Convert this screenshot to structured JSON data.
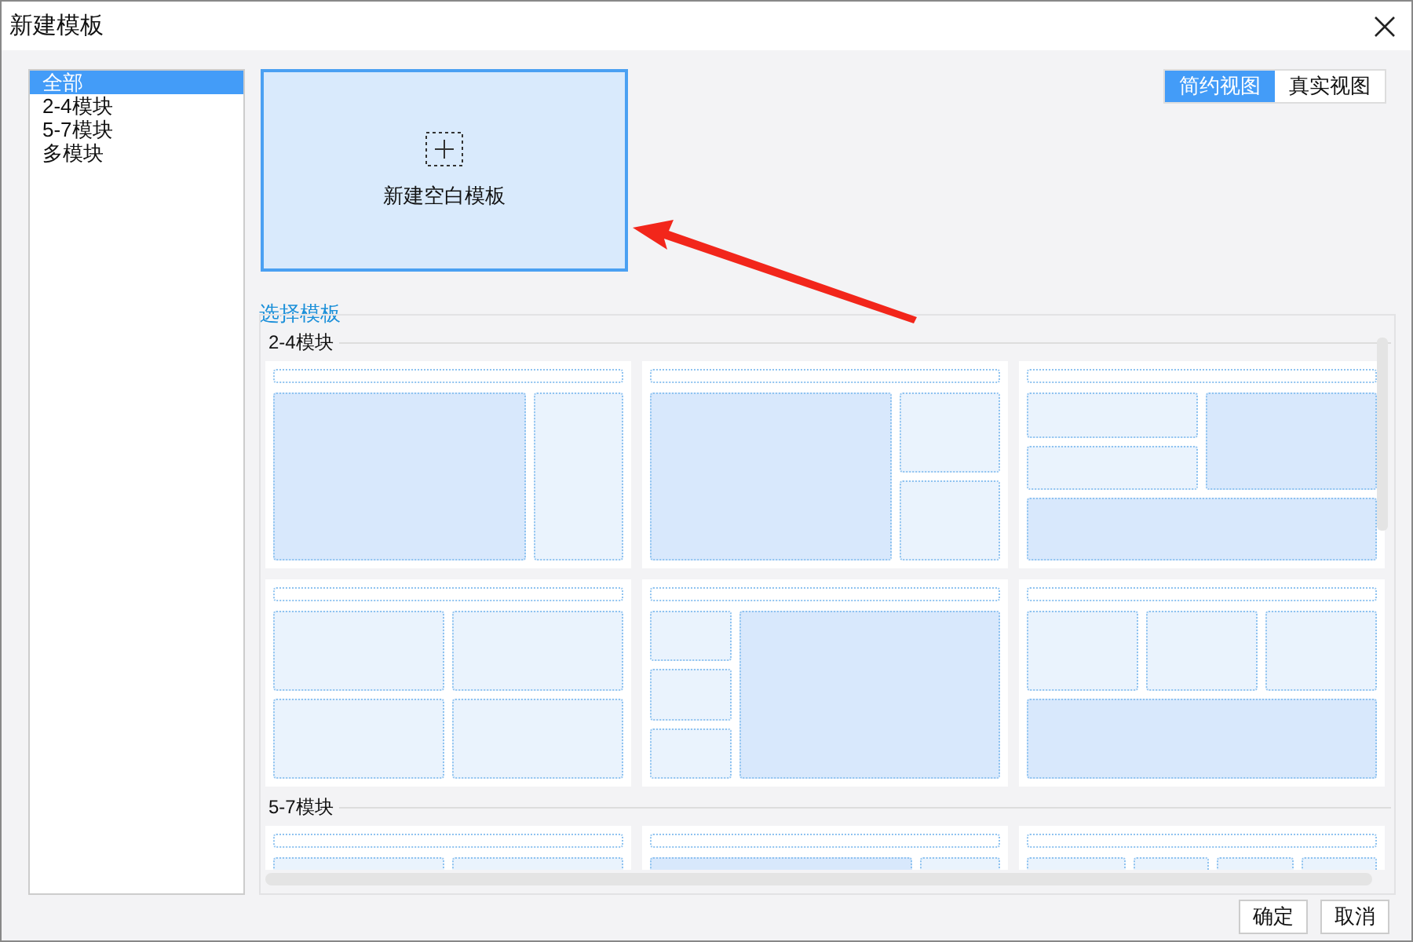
{
  "window": {
    "title": "新建模板"
  },
  "sidebar": {
    "items": [
      {
        "label": "全部",
        "selected": true
      },
      {
        "label": "2-4模块",
        "selected": false
      },
      {
        "label": "5-7模块",
        "selected": false
      },
      {
        "label": "多模块",
        "selected": false
      }
    ]
  },
  "new_template": {
    "label": "新建空白模板"
  },
  "view_toggle": [
    {
      "label": "简约视图",
      "selected": true
    },
    {
      "label": "真实视图",
      "selected": false
    }
  ],
  "template_panel": {
    "title": "选择模板",
    "sections": [
      {
        "title": "2-4模块",
        "templates": [
          {
            "kind": "main-side"
          },
          {
            "kind": "main-stack"
          },
          {
            "kind": "split-bottom"
          },
          {
            "kind": "quad"
          },
          {
            "kind": "side-stack"
          },
          {
            "kind": "three-top"
          }
        ]
      },
      {
        "title": "5-7模块",
        "templates": [
          {
            "kind": "pair-rows"
          },
          {
            "kind": "wide-narrow"
          },
          {
            "kind": "four-col"
          }
        ]
      }
    ]
  },
  "buttons": [
    "确定",
    "取消"
  ]
}
